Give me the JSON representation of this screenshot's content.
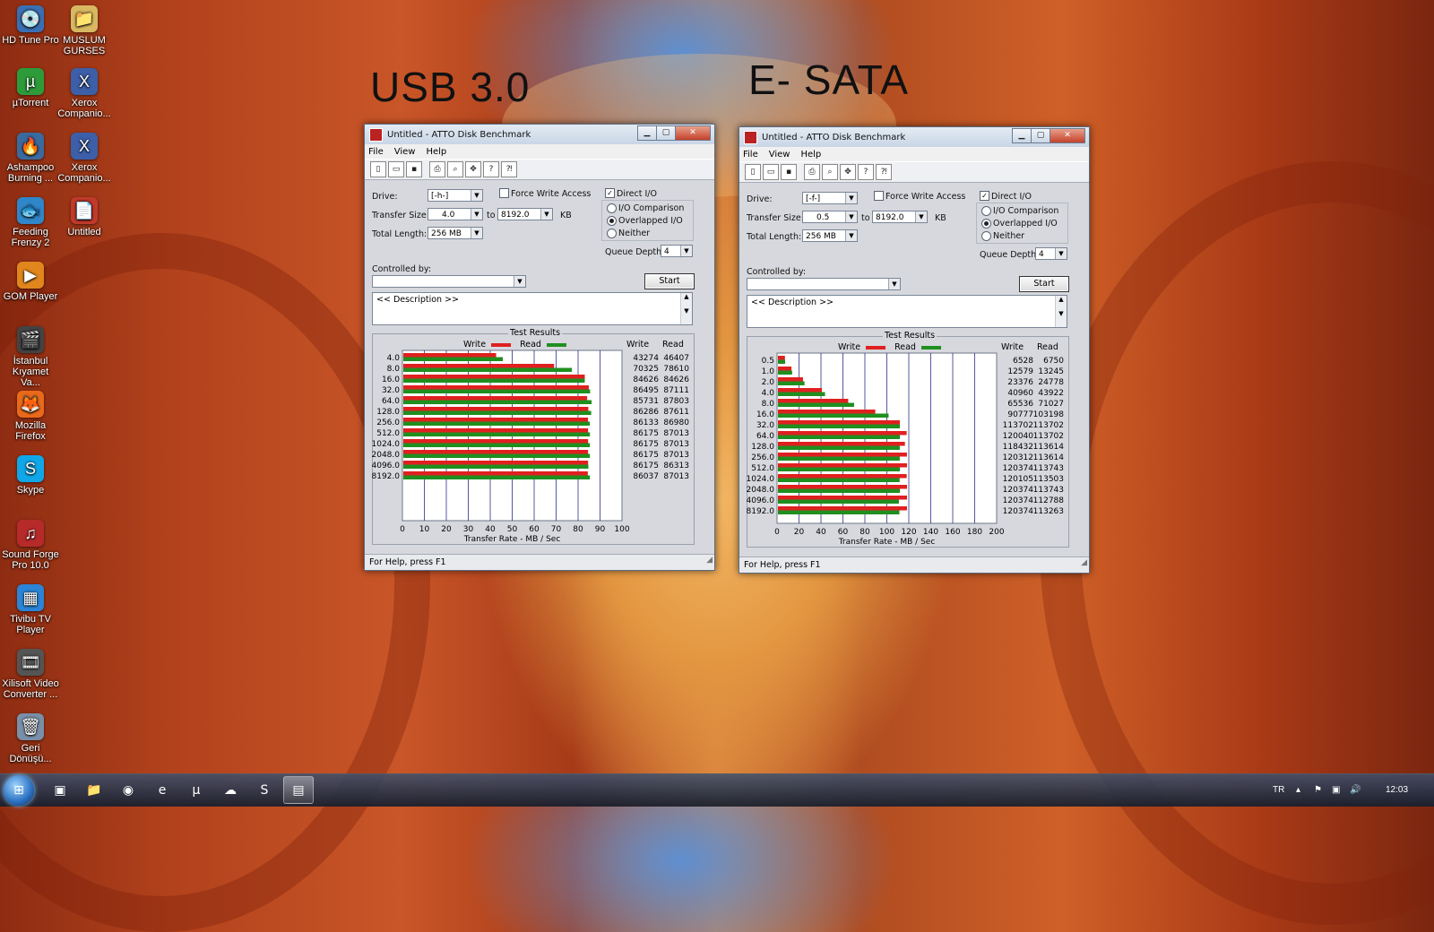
{
  "desktop": {
    "icons": [
      {
        "label": "HD Tune Pro",
        "glyph": "💿",
        "color": "#3b6fb3",
        "icon": "hd-tune-icon",
        "x": 2,
        "y": 6
      },
      {
        "label": "MUSLUM GURSES",
        "glyph": "📁",
        "color": "#d8b861",
        "icon": "folder-icon",
        "x": 62,
        "y": 6
      },
      {
        "label": "µTorrent",
        "glyph": "µ",
        "color": "#2e9b3a",
        "icon": "utorrent-icon",
        "x": 2,
        "y": 76
      },
      {
        "label": "Xerox Companio...",
        "glyph": "X",
        "color": "#3d5fa8",
        "icon": "xerox-icon",
        "x": 62,
        "y": 76
      },
      {
        "label": "Ashampoo Burning ...",
        "glyph": "🔥",
        "color": "#3b6a9e",
        "icon": "ashampoo-icon",
        "x": 2,
        "y": 148
      },
      {
        "label": "Xerox Companio...",
        "glyph": "X",
        "color": "#3d5fa8",
        "icon": "xerox-icon",
        "x": 62,
        "y": 148
      },
      {
        "label": "Feeding Frenzy 2",
        "glyph": "🐟",
        "color": "#2f86c8",
        "icon": "game-icon",
        "x": 2,
        "y": 220
      },
      {
        "label": "Untitled",
        "glyph": "📄",
        "color": "#c23a2b",
        "icon": "document-icon",
        "x": 62,
        "y": 220
      },
      {
        "label": "GOM Player",
        "glyph": "▶",
        "color": "#e0861d",
        "icon": "media-player-icon",
        "x": 2,
        "y": 292
      },
      {
        "label": "İstanbul Kıyamet Va...",
        "glyph": "🎬",
        "color": "#444",
        "icon": "movie-icon",
        "x": 2,
        "y": 364
      },
      {
        "label": "Mozilla Firefox",
        "glyph": "🦊",
        "color": "#e96a1b",
        "icon": "firefox-icon",
        "x": 2,
        "y": 436
      },
      {
        "label": "Skype",
        "glyph": "S",
        "color": "#10a7e8",
        "icon": "skype-icon",
        "x": 2,
        "y": 508
      },
      {
        "label": "Sound Forge Pro 10.0",
        "glyph": "♫",
        "color": "#b62a2a",
        "icon": "sound-forge-icon",
        "x": 2,
        "y": 580
      },
      {
        "label": "Tivibu TV Player",
        "glyph": "▦",
        "color": "#2b84d6",
        "icon": "tv-player-icon",
        "x": 2,
        "y": 652
      },
      {
        "label": "Xilisoft Video Converter ...",
        "glyph": "🎞",
        "color": "#555",
        "icon": "video-converter-icon",
        "x": 2,
        "y": 724
      },
      {
        "label": "Geri Dönüşü...",
        "glyph": "🗑",
        "color": "#7a8fa8",
        "icon": "recycle-bin-icon",
        "x": 2,
        "y": 796
      }
    ],
    "labels": {
      "left": "USB 3.0",
      "right": "E- SATA"
    }
  },
  "windows": [
    {
      "title": "Untitled - ATTO Disk Benchmark",
      "menu": [
        "File",
        "View",
        "Help"
      ],
      "drive_label": "Drive:",
      "drive": "[-h-]",
      "force_write": "Force Write Access",
      "direct_io": "Direct I/O",
      "transfer_label": "Transfer Size:",
      "transfer_from": "4.0",
      "to": "to",
      "transfer_to": "8192.0",
      "kb": "KB",
      "length_label": "Total Length:",
      "length": "256 MB",
      "io_comparison": "I/O Comparison",
      "overlapped": "Overlapped I/O",
      "neither": "Neither",
      "queue_label": "Queue Depth:",
      "queue": "4",
      "controlled_label": "Controlled by:",
      "controlled": "",
      "start": "Start",
      "description": "<< Description >>",
      "results_title": "Test Results",
      "legend_write": "Write",
      "legend_read": "Read",
      "col_write": "Write",
      "col_read": "Read",
      "status": "For Help, press F1"
    },
    {
      "title": "Untitled - ATTO Disk Benchmark",
      "menu": [
        "File",
        "View",
        "Help"
      ],
      "drive_label": "Drive:",
      "drive": "[-f-]",
      "force_write": "Force Write Access",
      "direct_io": "Direct I/O",
      "transfer_label": "Transfer Size:",
      "transfer_from": "0.5",
      "to": "to",
      "transfer_to": "8192.0",
      "kb": "KB",
      "length_label": "Total Length:",
      "length": "256 MB",
      "io_comparison": "I/O Comparison",
      "overlapped": "Overlapped I/O",
      "neither": "Neither",
      "queue_label": "Queue Depth:",
      "queue": "4",
      "controlled_label": "Controlled by:",
      "controlled": "",
      "start": "Start",
      "description": "<< Description >>",
      "results_title": "Test Results",
      "legend_write": "Write",
      "legend_read": "Read",
      "col_write": "Write",
      "col_read": "Read",
      "status": "For Help, press F1"
    }
  ],
  "chart_data": [
    {
      "type": "bar",
      "orientation": "horizontal",
      "title": "Test Results",
      "xlabel": "Transfer Rate - MB / Sec",
      "xlim": [
        0,
        100
      ],
      "xticks": [
        "0",
        "10",
        "20",
        "30",
        "40",
        "50",
        "60",
        "70",
        "80",
        "90",
        "100"
      ],
      "categories": [
        "4.0",
        "8.0",
        "16.0",
        "32.0",
        "64.0",
        "128.0",
        "256.0",
        "512.0",
        "1024.0",
        "2048.0",
        "4096.0",
        "8192.0"
      ],
      "series": [
        {
          "name": "Write",
          "color": "#e02020",
          "values": [
            43274,
            70325,
            84626,
            86495,
            85731,
            86286,
            86133,
            86175,
            86175,
            86175,
            86175,
            86037
          ]
        },
        {
          "name": "Read",
          "color": "#1f8f1f",
          "values": [
            46407,
            78610,
            84626,
            87111,
            87803,
            87611,
            86980,
            87013,
            87013,
            87013,
            86313,
            87013
          ]
        }
      ],
      "value_unit": "KB/s"
    },
    {
      "type": "bar",
      "orientation": "horizontal",
      "title": "Test Results",
      "xlabel": "Transfer Rate - MB / Sec",
      "xlim": [
        0,
        200
      ],
      "xticks": [
        "0",
        "20",
        "40",
        "60",
        "80",
        "100",
        "120",
        "140",
        "160",
        "180",
        "200"
      ],
      "categories": [
        "0.5",
        "1.0",
        "2.0",
        "4.0",
        "8.0",
        "16.0",
        "32.0",
        "64.0",
        "128.0",
        "256.0",
        "512.0",
        "1024.0",
        "2048.0",
        "4096.0",
        "8192.0"
      ],
      "series": [
        {
          "name": "Write",
          "color": "#e02020",
          "values": [
            6528,
            12579,
            23376,
            40960,
            65536,
            90777,
            113702,
            120040,
            118432,
            120312,
            120374,
            120105,
            120374,
            120374,
            120374
          ]
        },
        {
          "name": "Read",
          "color": "#1f8f1f",
          "values": [
            6750,
            13245,
            24778,
            43922,
            71027,
            103198,
            113702,
            113702,
            113614,
            113614,
            113743,
            113503,
            113743,
            112788,
            113263
          ]
        }
      ],
      "value_unit": "KB/s"
    }
  ],
  "taskbar": {
    "buttons": [
      {
        "glyph": "▣",
        "icon": "media-center-icon"
      },
      {
        "glyph": "📁",
        "icon": "explorer-icon"
      },
      {
        "glyph": "◉",
        "icon": "firefox-icon"
      },
      {
        "glyph": "e",
        "icon": "internet-explorer-icon"
      },
      {
        "glyph": "µ",
        "icon": "utorrent-icon"
      },
      {
        "glyph": "☁",
        "icon": "network-icon"
      },
      {
        "glyph": "S",
        "icon": "skype-icon"
      },
      {
        "glyph": "▤",
        "icon": "atto-benchmark-icon",
        "active": true
      }
    ],
    "lang": "TR",
    "clock": "12:03"
  }
}
